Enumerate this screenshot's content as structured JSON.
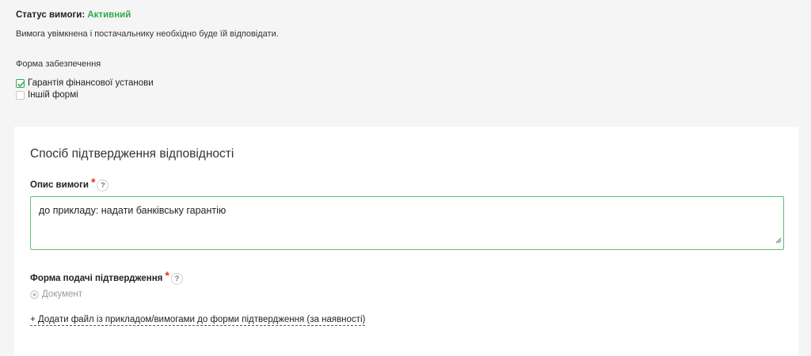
{
  "status": {
    "label": "Статус вимоги:",
    "value": "Активний",
    "value_color": "#2eac4e",
    "description": "Вимога увімкнена і постачальнику необхідно буде їй відповідати."
  },
  "security_form": {
    "label": "Форма забезпечення",
    "options": [
      {
        "label": "Гарантія фінансової установи",
        "checked": true
      },
      {
        "label": "Іншій формі",
        "checked": false
      }
    ]
  },
  "confirmation": {
    "title": "Спосіб підтвердження відповідності",
    "description_field": {
      "label": "Опис вимоги",
      "required_mark": "*",
      "help": "?",
      "value": "до прикладу: надати банківську гарантію"
    },
    "submission_field": {
      "label": "Форма подачі підтвердження",
      "required_mark": "*",
      "help": "?",
      "option": "Документ"
    },
    "add_file_link": "+ Додати файл із прикладом/вимогами до форми підтвердження (за наявності)"
  }
}
